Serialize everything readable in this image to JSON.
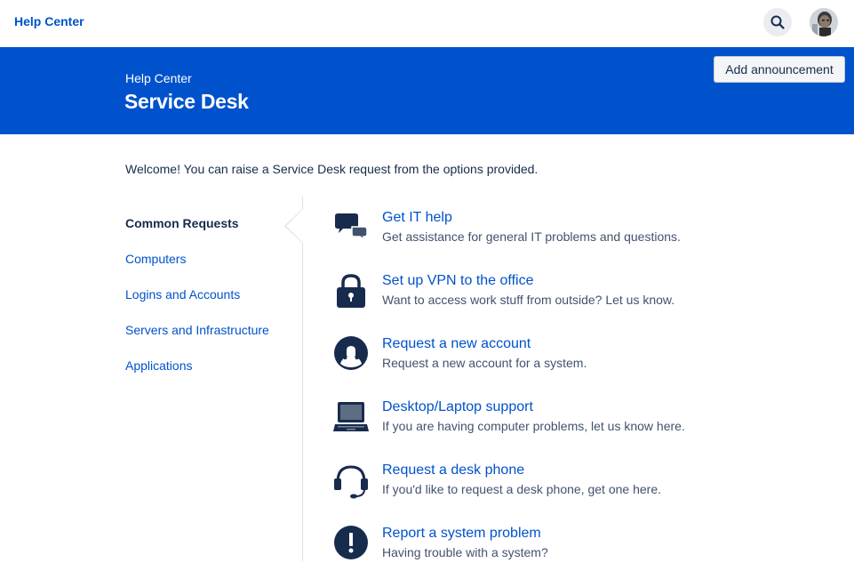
{
  "header": {
    "brand": "Help Center",
    "search_icon": "search-icon",
    "avatar": "user-avatar"
  },
  "banner": {
    "subtitle": "Help Center",
    "title": "Service Desk",
    "announcement_button": "Add announcement",
    "color": "#0052cc"
  },
  "welcome": "Welcome! You can raise a Service Desk request from the options provided.",
  "nav": {
    "items": [
      {
        "label": "Common Requests",
        "active": true
      },
      {
        "label": "Computers",
        "active": false
      },
      {
        "label": "Logins and Accounts",
        "active": false
      },
      {
        "label": "Servers and Infrastructure",
        "active": false
      },
      {
        "label": "Applications",
        "active": false
      }
    ]
  },
  "requests": [
    {
      "title": "Get IT help",
      "description": "Get assistance for general IT problems and questions.",
      "icon": "chat-bubbles-icon"
    },
    {
      "title": "Set up VPN to the office",
      "description": "Want to access work stuff from outside? Let us know.",
      "icon": "padlock-icon"
    },
    {
      "title": "Request a new account",
      "description": "Request a new account for a system.",
      "icon": "person-silhouette-icon"
    },
    {
      "title": "Desktop/Laptop support",
      "description": "If you are having computer problems, let us know here.",
      "icon": "laptop-icon"
    },
    {
      "title": "Request a desk phone",
      "description": "If you'd like to request a desk phone, get one here.",
      "icon": "headset-icon"
    },
    {
      "title": "Report a system problem",
      "description": "Having trouble with a system?",
      "icon": "exclamation-icon"
    }
  ],
  "colors": {
    "link": "#0052cc",
    "text": "#172b4d",
    "muted": "#42526e"
  }
}
